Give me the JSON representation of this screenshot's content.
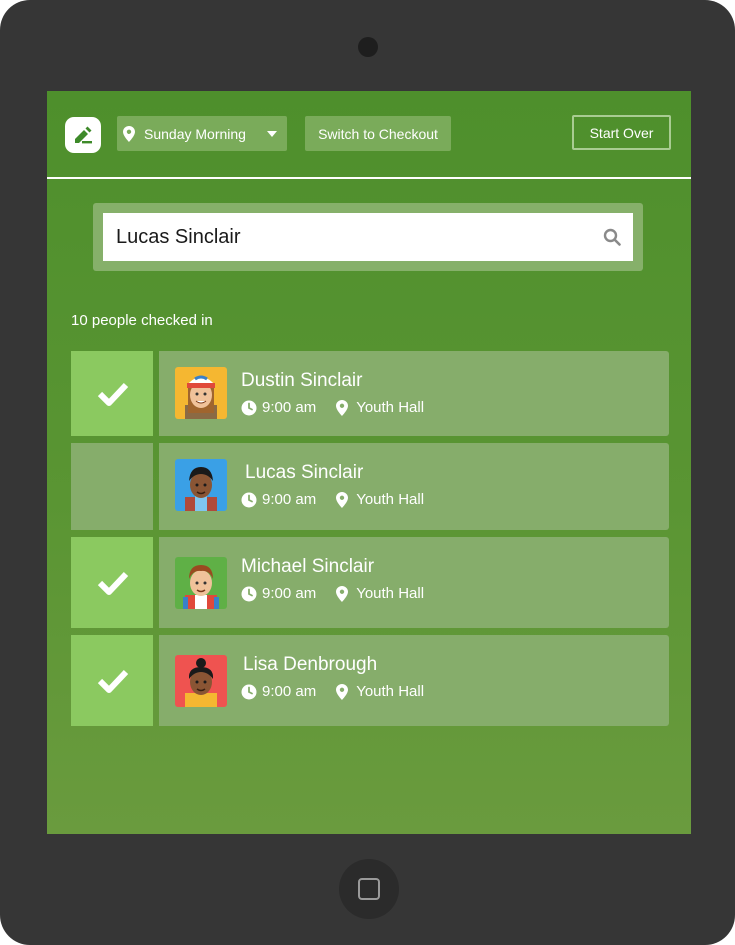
{
  "header": {
    "location_select": "Sunday Morning",
    "switch_label": "Switch to Checkout",
    "start_over_label": "Start Over"
  },
  "search": {
    "value": "Lucas Sinclair"
  },
  "checked_in_summary": "10 people checked in",
  "people": [
    {
      "name": "Dustin Sinclair",
      "time": "9:00 am",
      "location": "Youth Hall",
      "checked": true
    },
    {
      "name": "Lucas Sinclair",
      "time": "9:00 am",
      "location": "Youth Hall",
      "checked": false
    },
    {
      "name": "Michael Sinclair",
      "time": "9:00 am",
      "location": "Youth Hall",
      "checked": true
    },
    {
      "name": "Lisa Denbrough",
      "time": "9:00 am",
      "location": "Youth Hall",
      "checked": true
    }
  ],
  "colors": {
    "screen_green": "#4e8f2c",
    "check_active": "#8bc960",
    "card": "#86ad6b",
    "device": "#363636"
  }
}
